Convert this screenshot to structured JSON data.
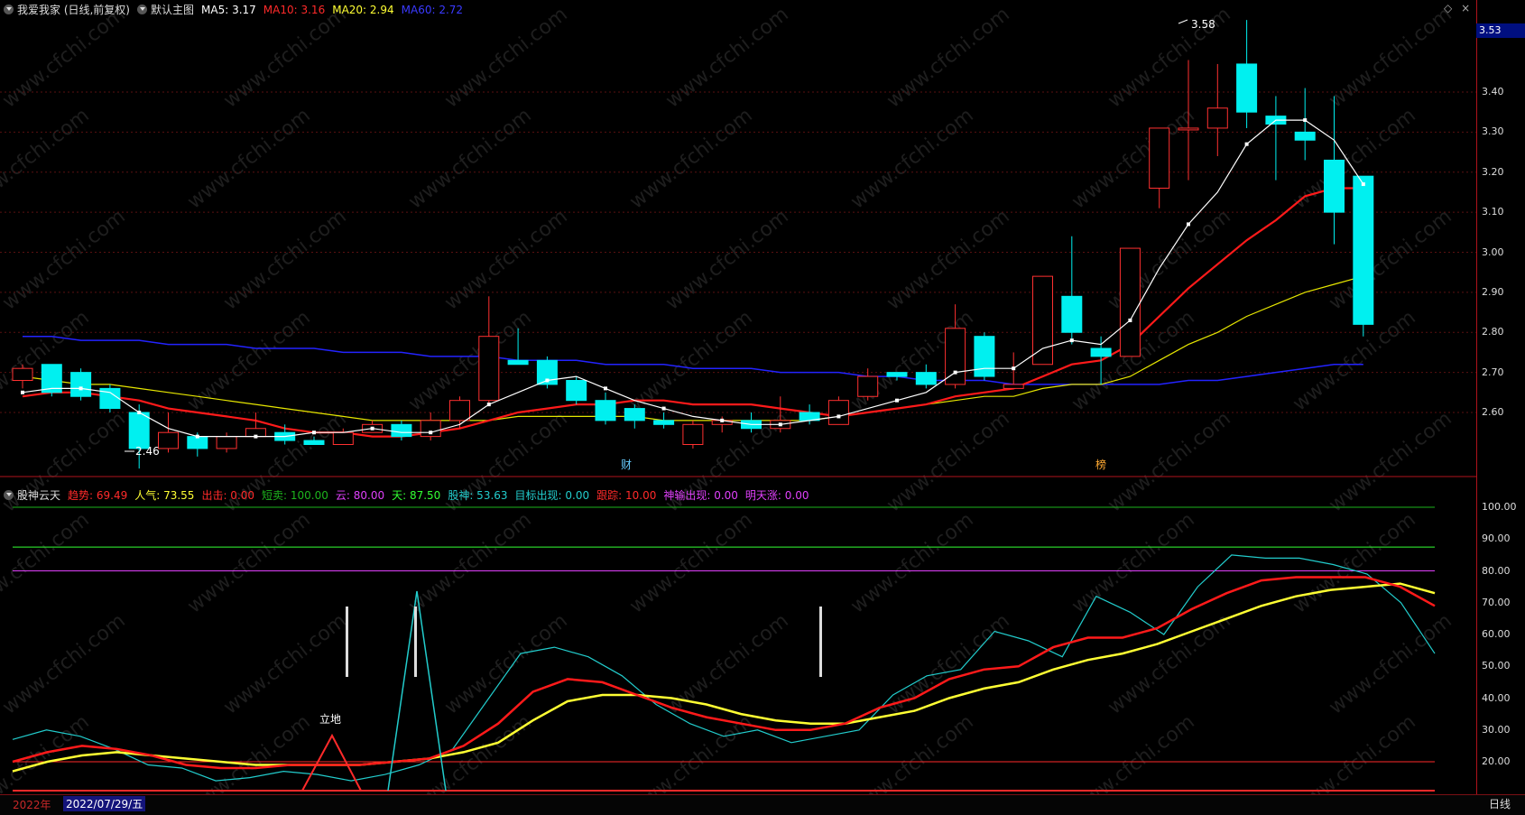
{
  "upper_legend": {
    "stock": "我爱我家 (日线,前复权)",
    "chart_name": "默认主图",
    "ma5": "MA5: 3.17",
    "ma10": "MA10: 3.16",
    "ma20": "MA20: 2.94",
    "ma60": "MA60: 2.72"
  },
  "lower_legend": {
    "indicator": "股神云天",
    "items": [
      {
        "text": "趋势: 69.49",
        "color": "#ff2a2a"
      },
      {
        "text": "人气: 73.55",
        "color": "#ffff33"
      },
      {
        "text": "出击: 0.00",
        "color": "#ff2a2a"
      },
      {
        "text": "短卖: 100.00",
        "color": "#1db41d"
      },
      {
        "text": "云: 80.00",
        "color": "#e040fb"
      },
      {
        "text": "天: 87.50",
        "color": "#33ff33"
      },
      {
        "text": "股神: 53.63",
        "color": "#22cccc"
      },
      {
        "text": "目标出现: 0.00",
        "color": "#22cccc"
      },
      {
        "text": "跟踪: 10.00",
        "color": "#ff2a2a"
      },
      {
        "text": "神输出现: 0.00",
        "color": "#e040fb"
      },
      {
        "text": "明天涨: 0.00",
        "color": "#e040fb"
      }
    ]
  },
  "price_axis": [
    "3.40",
    "3.30",
    "3.20",
    "3.10",
    "3.00",
    "2.90",
    "2.80",
    "2.70",
    "2.60"
  ],
  "indicator_axis": [
    "100.00",
    "90.00",
    "80.00",
    "70.00",
    "60.00",
    "50.00",
    "40.00",
    "30.00",
    "20.00"
  ],
  "current_price_tag": "3.53",
  "annotations": {
    "high": "3.58",
    "low": "2.46",
    "marker_cai": "财",
    "marker_bang": "榜",
    "lidi": "立地"
  },
  "bottom_bar": {
    "year": "2022年",
    "date": "2022/07/29/五",
    "period": "日线"
  },
  "watermark": "www.cfchi.com",
  "colors": {
    "up": "#ff3030",
    "down": "#00f0f0",
    "ma5": "#ffffff",
    "ma10": "#ff1a1a",
    "ma20": "#e6e600",
    "ma60": "#2323ff",
    "axis": "#b0131b"
  },
  "chart_data": {
    "type": "candlestick",
    "price_range": [
      2.46,
      3.58
    ],
    "candles": [
      {
        "o": 2.68,
        "c": 2.71,
        "h": 2.72,
        "l": 2.66
      },
      {
        "o": 2.72,
        "c": 2.65,
        "h": 2.72,
        "l": 2.64
      },
      {
        "o": 2.7,
        "c": 2.64,
        "h": 2.71,
        "l": 2.63
      },
      {
        "o": 2.66,
        "c": 2.61,
        "h": 2.67,
        "l": 2.6
      },
      {
        "o": 2.6,
        "c": 2.51,
        "h": 2.62,
        "l": 2.46
      },
      {
        "o": 2.51,
        "c": 2.55,
        "h": 2.6,
        "l": 2.5
      },
      {
        "o": 2.54,
        "c": 2.51,
        "h": 2.55,
        "l": 2.49
      },
      {
        "o": 2.51,
        "c": 2.54,
        "h": 2.55,
        "l": 2.5
      },
      {
        "o": 2.54,
        "c": 2.56,
        "h": 2.6,
        "l": 2.54
      },
      {
        "o": 2.55,
        "c": 2.53,
        "h": 2.57,
        "l": 2.52
      },
      {
        "o": 2.53,
        "c": 2.52,
        "h": 2.54,
        "l": 2.52
      },
      {
        "o": 2.52,
        "c": 2.55,
        "h": 2.56,
        "l": 2.52
      },
      {
        "o": 2.55,
        "c": 2.57,
        "h": 2.58,
        "l": 2.55
      },
      {
        "o": 2.57,
        "c": 2.54,
        "h": 2.58,
        "l": 2.53
      },
      {
        "o": 2.54,
        "c": 2.58,
        "h": 2.6,
        "l": 2.53
      },
      {
        "o": 2.58,
        "c": 2.63,
        "h": 2.64,
        "l": 2.56
      },
      {
        "o": 2.63,
        "c": 2.79,
        "h": 2.89,
        "l": 2.62
      },
      {
        "o": 2.73,
        "c": 2.72,
        "h": 2.81,
        "l": 2.72
      },
      {
        "o": 2.73,
        "c": 2.67,
        "h": 2.74,
        "l": 2.66
      },
      {
        "o": 2.68,
        "c": 2.63,
        "h": 2.69,
        "l": 2.62
      },
      {
        "o": 2.63,
        "c": 2.58,
        "h": 2.65,
        "l": 2.57
      },
      {
        "o": 2.61,
        "c": 2.58,
        "h": 2.62,
        "l": 2.56
      },
      {
        "o": 2.58,
        "c": 2.57,
        "h": 2.6,
        "l": 2.56
      },
      {
        "o": 2.52,
        "c": 2.57,
        "h": 2.58,
        "l": 2.51
      },
      {
        "o": 2.57,
        "c": 2.58,
        "h": 2.59,
        "l": 2.55
      },
      {
        "o": 2.58,
        "c": 2.56,
        "h": 2.6,
        "l": 2.55
      },
      {
        "o": 2.56,
        "c": 2.58,
        "h": 2.64,
        "l": 2.55
      },
      {
        "o": 2.6,
        "c": 2.58,
        "h": 2.62,
        "l": 2.57
      },
      {
        "o": 2.57,
        "c": 2.63,
        "h": 2.64,
        "l": 2.57
      },
      {
        "o": 2.64,
        "c": 2.69,
        "h": 2.71,
        "l": 2.63
      },
      {
        "o": 2.7,
        "c": 2.69,
        "h": 2.7,
        "l": 2.68
      },
      {
        "o": 2.7,
        "c": 2.67,
        "h": 2.72,
        "l": 2.66
      },
      {
        "o": 2.67,
        "c": 2.81,
        "h": 2.87,
        "l": 2.66
      },
      {
        "o": 2.79,
        "c": 2.69,
        "h": 2.8,
        "l": 2.68
      },
      {
        "o": 2.66,
        "c": 2.67,
        "h": 2.75,
        "l": 2.66
      },
      {
        "o": 2.72,
        "c": 2.94,
        "h": 2.94,
        "l": 2.72
      },
      {
        "o": 2.89,
        "c": 2.8,
        "h": 3.04,
        "l": 2.77
      },
      {
        "o": 2.76,
        "c": 2.74,
        "h": 2.79,
        "l": 2.67
      },
      {
        "o": 2.74,
        "c": 3.01,
        "h": 3.01,
        "l": 2.74
      },
      {
        "o": 3.16,
        "c": 3.31,
        "h": 3.31,
        "l": 3.11
      },
      {
        "o": 3.31,
        "c": 3.31,
        "h": 3.48,
        "l": 3.18
      },
      {
        "o": 3.31,
        "c": 3.36,
        "h": 3.47,
        "l": 3.24
      },
      {
        "o": 3.47,
        "c": 3.35,
        "h": 3.58,
        "l": 3.31
      },
      {
        "o": 3.34,
        "c": 3.32,
        "h": 3.39,
        "l": 3.18
      },
      {
        "o": 3.3,
        "c": 3.28,
        "h": 3.41,
        "l": 3.23
      },
      {
        "o": 3.23,
        "c": 3.1,
        "h": 3.39,
        "l": 3.02
      },
      {
        "o": 3.19,
        "c": 2.82,
        "h": 3.19,
        "l": 2.79
      }
    ],
    "ma5": [
      2.65,
      2.66,
      2.66,
      2.65,
      2.6,
      2.56,
      2.54,
      2.54,
      2.54,
      2.54,
      2.55,
      2.55,
      2.56,
      2.55,
      2.55,
      2.57,
      2.62,
      2.65,
      2.68,
      2.69,
      2.66,
      2.63,
      2.61,
      2.59,
      2.58,
      2.57,
      2.57,
      2.58,
      2.59,
      2.61,
      2.63,
      2.65,
      2.7,
      2.71,
      2.71,
      2.76,
      2.78,
      2.77,
      2.83,
      2.96,
      3.07,
      3.15,
      3.27,
      3.33,
      3.33,
      3.28,
      3.17
    ],
    "ma10": [
      2.64,
      2.65,
      2.65,
      2.64,
      2.63,
      2.61,
      2.6,
      2.59,
      2.58,
      2.56,
      2.55,
      2.55,
      2.54,
      2.54,
      2.55,
      2.56,
      2.58,
      2.6,
      2.61,
      2.62,
      2.62,
      2.63,
      2.63,
      2.62,
      2.62,
      2.62,
      2.61,
      2.6,
      2.59,
      2.6,
      2.61,
      2.62,
      2.64,
      2.65,
      2.66,
      2.69,
      2.72,
      2.73,
      2.77,
      2.84,
      2.91,
      2.97,
      3.03,
      3.08,
      3.14,
      3.16,
      3.16
    ],
    "ma20": [
      2.69,
      2.68,
      2.67,
      2.67,
      2.66,
      2.65,
      2.64,
      2.63,
      2.62,
      2.61,
      2.6,
      2.59,
      2.58,
      2.58,
      2.58,
      2.58,
      2.58,
      2.59,
      2.59,
      2.59,
      2.59,
      2.59,
      2.58,
      2.58,
      2.58,
      2.58,
      2.58,
      2.58,
      2.59,
      2.6,
      2.61,
      2.62,
      2.63,
      2.64,
      2.64,
      2.66,
      2.67,
      2.67,
      2.69,
      2.73,
      2.77,
      2.8,
      2.84,
      2.87,
      2.9,
      2.92,
      2.94
    ],
    "ma60": [
      2.79,
      2.79,
      2.78,
      2.78,
      2.78,
      2.77,
      2.77,
      2.77,
      2.76,
      2.76,
      2.76,
      2.75,
      2.75,
      2.75,
      2.74,
      2.74,
      2.74,
      2.73,
      2.73,
      2.73,
      2.72,
      2.72,
      2.72,
      2.71,
      2.71,
      2.71,
      2.7,
      2.7,
      2.7,
      2.69,
      2.69,
      2.68,
      2.68,
      2.68,
      2.67,
      2.67,
      2.67,
      2.67,
      2.67,
      2.67,
      2.68,
      2.68,
      2.69,
      2.7,
      2.71,
      2.72,
      2.72
    ],
    "indicator": {
      "range": [
        10,
        100
      ],
      "h_lines": [
        {
          "v": 100,
          "color": "#1db41d"
        },
        {
          "v": 87.5,
          "color": "#33ff33"
        },
        {
          "v": 80,
          "color": "#e040fb"
        },
        {
          "v": 20,
          "color": "#ff2a2a"
        }
      ],
      "trend": [
        20,
        23,
        25,
        24,
        22,
        19,
        18,
        18,
        19,
        19,
        19,
        20,
        21,
        25,
        32,
        42,
        46,
        45,
        41,
        37,
        34,
        32,
        30,
        30,
        32,
        37,
        40,
        46,
        49,
        50,
        56,
        59,
        59,
        62,
        68,
        73,
        77,
        78,
        78,
        78,
        75,
        69
      ],
      "popularity": [
        17,
        20,
        22,
        23,
        22,
        21,
        20,
        19,
        19,
        19,
        19,
        20,
        21,
        23,
        26,
        33,
        39,
        41,
        41,
        40,
        38,
        35,
        33,
        32,
        32,
        34,
        36,
        40,
        43,
        45,
        49,
        52,
        54,
        57,
        61,
        65,
        69,
        72,
        74,
        75,
        76,
        73
      ],
      "stock_god": [
        27,
        30,
        28,
        24,
        19,
        18,
        14,
        15,
        17,
        16,
        14,
        16,
        19,
        24,
        39,
        54,
        56,
        53,
        47,
        38,
        32,
        28,
        30,
        26,
        28,
        30,
        41,
        47,
        49,
        61,
        58,
        53,
        72,
        67,
        60,
        75,
        85,
        84,
        84,
        82,
        79,
        70,
        54
      ]
    }
  }
}
